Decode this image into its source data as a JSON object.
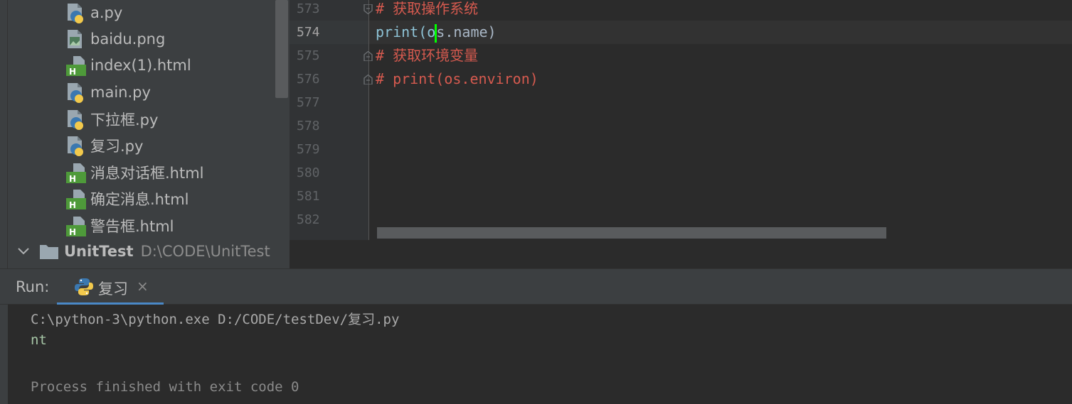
{
  "project_tree": {
    "files": [
      {
        "name": "a.py",
        "type": "python"
      },
      {
        "name": "baidu.png",
        "type": "image"
      },
      {
        "name": "index(1).html",
        "type": "html"
      },
      {
        "name": "main.py",
        "type": "python"
      },
      {
        "name": "下拉框.py",
        "type": "python"
      },
      {
        "name": "复习.py",
        "type": "python"
      },
      {
        "name": "消息对话框.html",
        "type": "html"
      },
      {
        "name": "确定消息.html",
        "type": "html"
      },
      {
        "name": "警告框.html",
        "type": "html"
      }
    ],
    "folder": {
      "name": "UnitTest",
      "path": "D:\\CODE\\UnitTest"
    }
  },
  "editor": {
    "line_numbers": [
      "573",
      "574",
      "575",
      "576",
      "577",
      "578",
      "579",
      "580",
      "581",
      "582"
    ],
    "active_line": "574",
    "code": {
      "line573": "# 获取操作系统",
      "line574_before_caret": "print(o",
      "line574_after_caret": "s.name)",
      "line575": "# 获取环境变量",
      "line576": "# print(os.environ)"
    }
  },
  "run_panel": {
    "label": "Run:",
    "tab_label": "复习",
    "close_glyph": "×",
    "console": {
      "command": "C:\\python-3\\python.exe D:/CODE/testDev/复习.py",
      "output": "nt",
      "finish": "Process finished with exit code 0"
    }
  },
  "colors": {
    "comment": "#d65a4f",
    "keyword": "#8ec3d6",
    "caret": "#00ff00",
    "tab_underline": "#4a88c7"
  }
}
